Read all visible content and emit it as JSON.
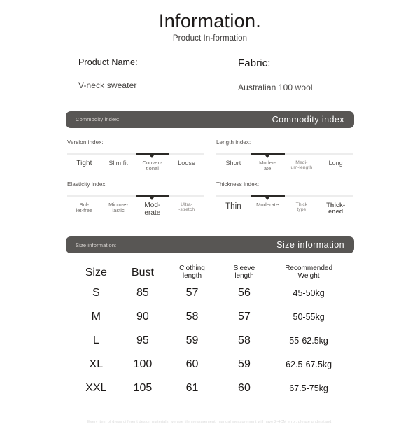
{
  "header": {
    "title": "Information.",
    "subtitle": "Product In-formation"
  },
  "product": {
    "name_label": "Product Name:",
    "name_value": "V-neck sweater",
    "fabric_label": "Fabric:",
    "fabric_value": "Australian 100 wool"
  },
  "commodity_banner": {
    "small_label": "Commodity index:",
    "large_label": "Commodity index"
  },
  "indices": [
    {
      "title": "Version index:",
      "active": 3,
      "options": [
        "Tight",
        "Slim fit",
        "Conven-\ntional",
        "Loose"
      ]
    },
    {
      "title": "Length index:",
      "active": 2,
      "options": [
        "Short",
        "Moder-\nate",
        "Medi-\num-length",
        "Long"
      ]
    },
    {
      "title": "Elasticity index:",
      "active": 3,
      "options": [
        "Bul-\nlet-free",
        "Micro-e-\nlastic",
        "Mod-\nerate",
        "Ultra-\n-stretch"
      ]
    },
    {
      "title": "Thickness index:",
      "active": 2,
      "options": [
        "Thin",
        "Moderate",
        "Thick\ntype",
        "Thick-\nened"
      ]
    }
  ],
  "size_banner": {
    "small_label": "Size information:",
    "large_label": "Size information"
  },
  "size_table": {
    "headers": [
      "Size",
      "Bust",
      "Clothing\nlength",
      "Sleeve\nlength",
      "Recommended\nWeight"
    ],
    "rows": [
      [
        "S",
        "85",
        "57",
        "56",
        "45-50kg"
      ],
      [
        "M",
        "90",
        "58",
        "57",
        "50-55kg"
      ],
      [
        "L",
        "95",
        "59",
        "58",
        "55-62.5kg"
      ],
      [
        "XL",
        "100",
        "60",
        "59",
        "62.5-67.5kg"
      ],
      [
        "XXL",
        "105",
        "61",
        "60",
        "67.5-75kg"
      ]
    ]
  },
  "footer": {
    "note": "Every item of dress different design materials, we use tile measurement, manual measurement will have 2-4CM error, please understand."
  },
  "colors": {
    "banner_bg": "#585654",
    "track_active": "#2b2926",
    "track_inactive": "#ededed",
    "text_primary": "#1d1a19"
  }
}
